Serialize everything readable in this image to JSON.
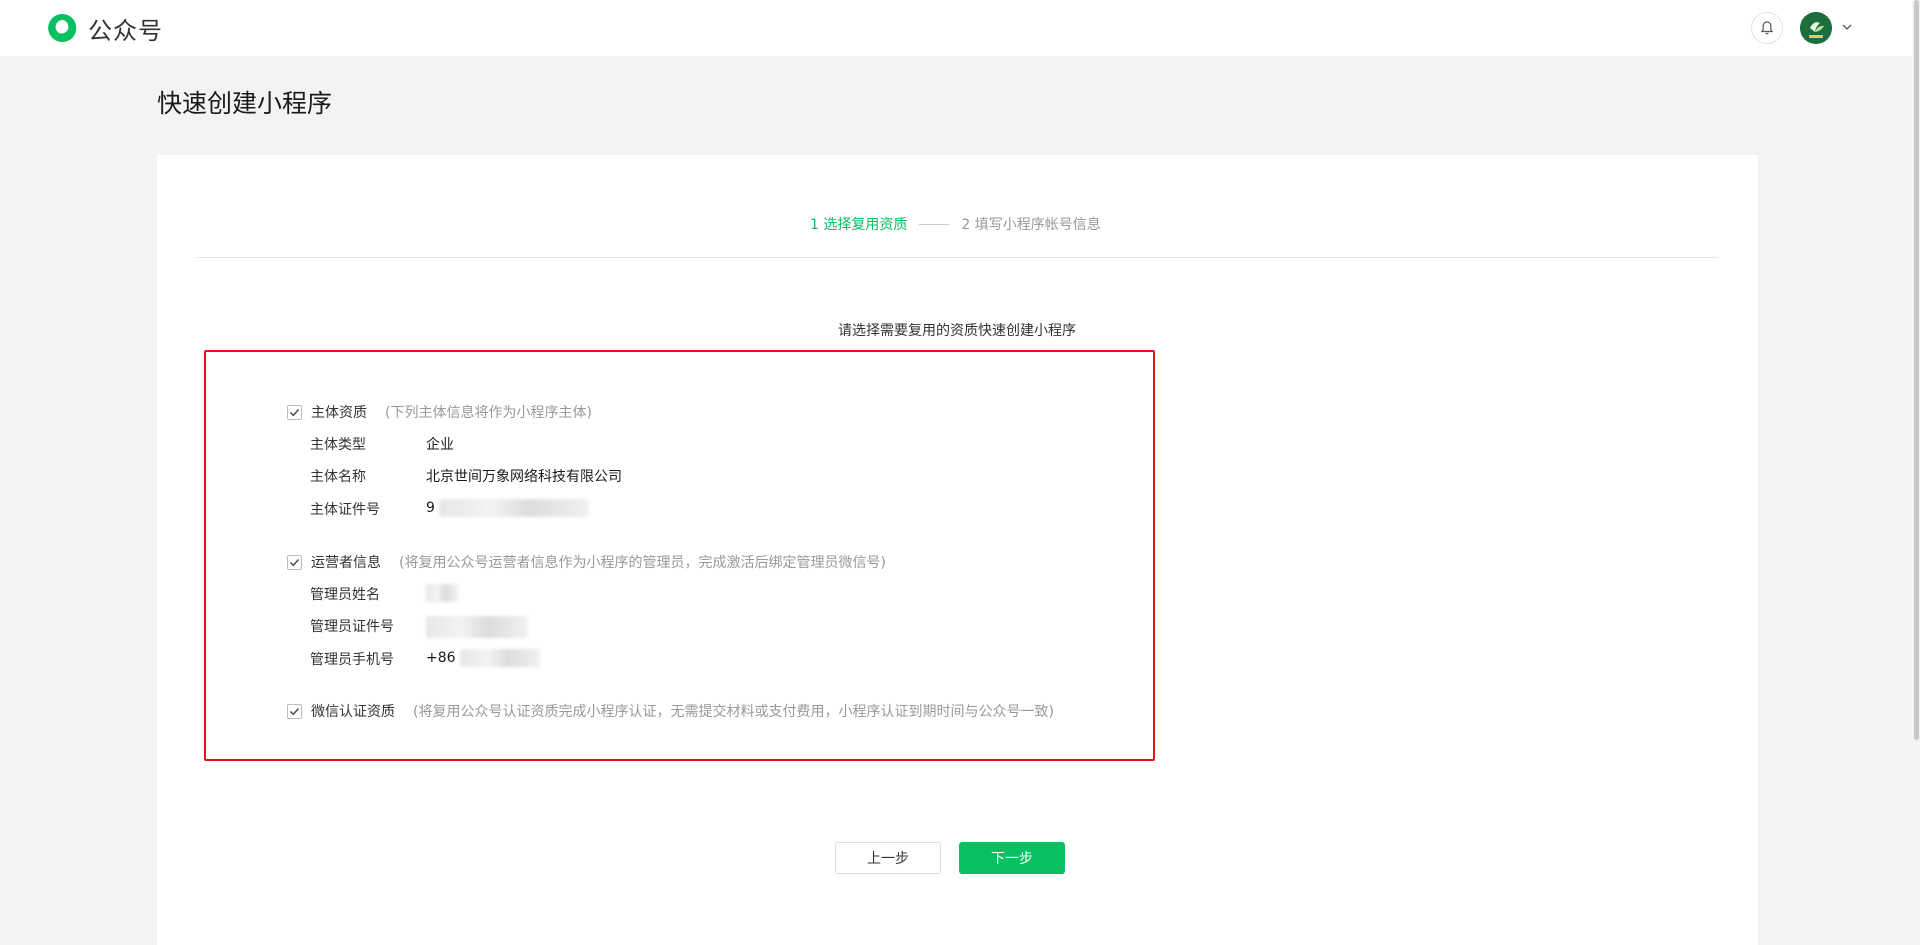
{
  "header": {
    "app_name": "公众号",
    "icons": {
      "logo": "wechat-official-accounts-logo",
      "notification": "bell-icon",
      "avatar_caret": "chevron-down-icon"
    },
    "brand_color": "#07c160"
  },
  "page": {
    "title": "快速创建小程序"
  },
  "steps": {
    "step1": "1 选择复用资质",
    "step2": "2 填写小程序帐号信息",
    "active_color": "#07c160"
  },
  "prompt": "请选择需要复用的资质快速创建小程序",
  "sections": {
    "entity": {
      "checked": true,
      "title": "主体资质",
      "note": "(下列主体信息将作为小程序主体)",
      "rows": [
        {
          "label": "主体类型",
          "value": "企业"
        },
        {
          "label": "主体名称",
          "value": "北京世间万象网络科技有限公司"
        },
        {
          "label": "主体证件号",
          "value": "9"
        }
      ]
    },
    "operator": {
      "checked": true,
      "title": "运营者信息",
      "note": "(将复用公众号运营者信息作为小程序的管理员，完成激活后绑定管理员微信号)",
      "rows": [
        {
          "label": "管理员姓名",
          "value": ""
        },
        {
          "label": "管理员证件号",
          "value": ""
        },
        {
          "label": "管理员手机号",
          "value": "+86"
        }
      ]
    },
    "verification": {
      "checked": true,
      "title": "微信认证资质",
      "note": "(将复用公众号认证资质完成小程序认证，无需提交材料或支付费用，小程序认证到期时间与公众号一致)"
    }
  },
  "highlight_color": "#e8101a",
  "buttons": {
    "prev": "上一步",
    "next": "下一步"
  }
}
